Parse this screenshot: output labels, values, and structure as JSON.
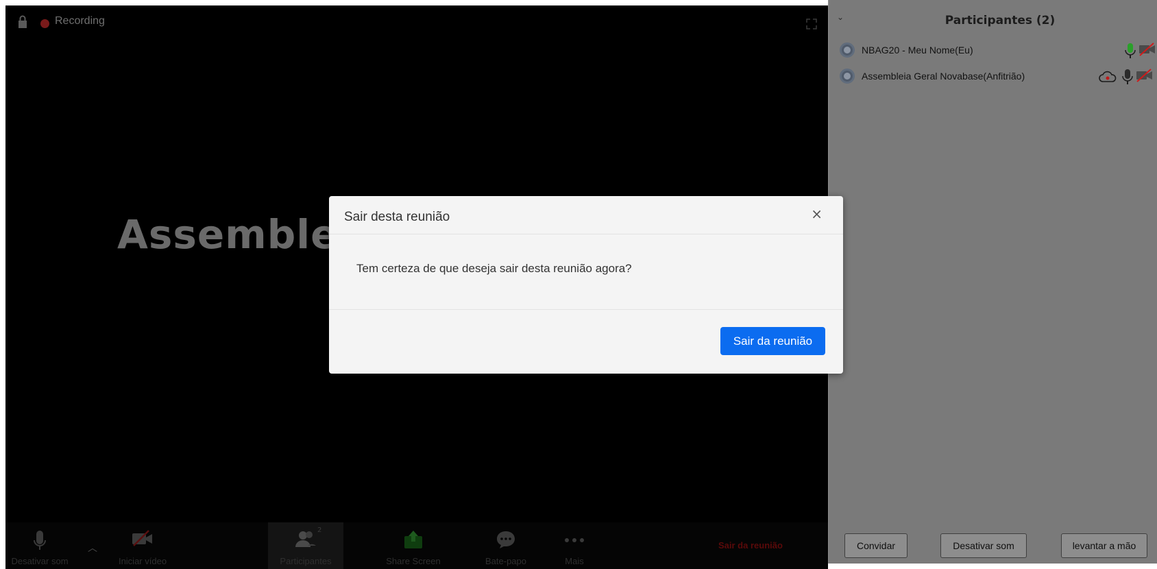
{
  "meeting": {
    "recording_label": "Recording",
    "speaker_name": "Assembleia"
  },
  "toolbar": {
    "mute_label": "Desativar som",
    "video_label": "Iniciar vídeo",
    "participants_label": "Participantes",
    "participants_count": "2",
    "share_label": "Share Screen",
    "chat_label": "Bate-papo",
    "more_label": "Mais",
    "leave_label": "Sair da reunião"
  },
  "panel": {
    "title": "Participantes (2)",
    "participants": [
      {
        "name": "NBAG20 - Meu Nome(Eu)"
      },
      {
        "name": "Assembleia Geral Novabase(Anfitrião)"
      }
    ],
    "footer": {
      "invite_label": "Convidar",
      "mute_all_label": "Desativar som",
      "raise_hand_label": "levantar a mão"
    }
  },
  "dialog": {
    "title": "Sair desta reunião",
    "message": "Tem certeza de que deseja sair desta reunião agora?",
    "leave_button": "Sair da reunião",
    "close_glyph": "×"
  },
  "colors": {
    "accent": "#0b6cf0",
    "leave_red": "#e02828",
    "mic_green": "#2aa02a"
  }
}
